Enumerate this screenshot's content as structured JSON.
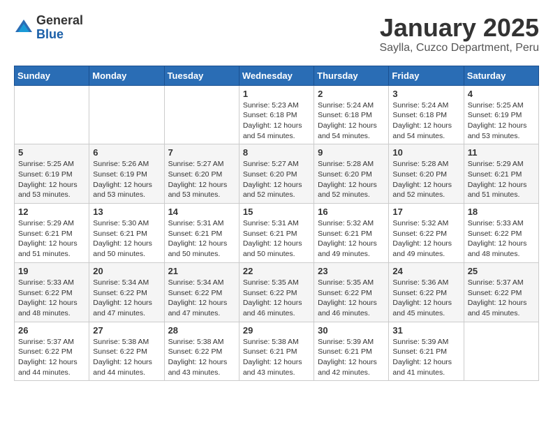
{
  "logo": {
    "general": "General",
    "blue": "Blue"
  },
  "title": "January 2025",
  "subtitle": "Saylla, Cuzco Department, Peru",
  "days_of_week": [
    "Sunday",
    "Monday",
    "Tuesday",
    "Wednesday",
    "Thursday",
    "Friday",
    "Saturday"
  ],
  "weeks": [
    [
      {
        "day": "",
        "info": ""
      },
      {
        "day": "",
        "info": ""
      },
      {
        "day": "",
        "info": ""
      },
      {
        "day": "1",
        "info": "Sunrise: 5:23 AM\nSunset: 6:18 PM\nDaylight: 12 hours\nand 54 minutes."
      },
      {
        "day": "2",
        "info": "Sunrise: 5:24 AM\nSunset: 6:18 PM\nDaylight: 12 hours\nand 54 minutes."
      },
      {
        "day": "3",
        "info": "Sunrise: 5:24 AM\nSunset: 6:18 PM\nDaylight: 12 hours\nand 54 minutes."
      },
      {
        "day": "4",
        "info": "Sunrise: 5:25 AM\nSunset: 6:19 PM\nDaylight: 12 hours\nand 53 minutes."
      }
    ],
    [
      {
        "day": "5",
        "info": "Sunrise: 5:25 AM\nSunset: 6:19 PM\nDaylight: 12 hours\nand 53 minutes."
      },
      {
        "day": "6",
        "info": "Sunrise: 5:26 AM\nSunset: 6:19 PM\nDaylight: 12 hours\nand 53 minutes."
      },
      {
        "day": "7",
        "info": "Sunrise: 5:27 AM\nSunset: 6:20 PM\nDaylight: 12 hours\nand 53 minutes."
      },
      {
        "day": "8",
        "info": "Sunrise: 5:27 AM\nSunset: 6:20 PM\nDaylight: 12 hours\nand 52 minutes."
      },
      {
        "day": "9",
        "info": "Sunrise: 5:28 AM\nSunset: 6:20 PM\nDaylight: 12 hours\nand 52 minutes."
      },
      {
        "day": "10",
        "info": "Sunrise: 5:28 AM\nSunset: 6:20 PM\nDaylight: 12 hours\nand 52 minutes."
      },
      {
        "day": "11",
        "info": "Sunrise: 5:29 AM\nSunset: 6:21 PM\nDaylight: 12 hours\nand 51 minutes."
      }
    ],
    [
      {
        "day": "12",
        "info": "Sunrise: 5:29 AM\nSunset: 6:21 PM\nDaylight: 12 hours\nand 51 minutes."
      },
      {
        "day": "13",
        "info": "Sunrise: 5:30 AM\nSunset: 6:21 PM\nDaylight: 12 hours\nand 50 minutes."
      },
      {
        "day": "14",
        "info": "Sunrise: 5:31 AM\nSunset: 6:21 PM\nDaylight: 12 hours\nand 50 minutes."
      },
      {
        "day": "15",
        "info": "Sunrise: 5:31 AM\nSunset: 6:21 PM\nDaylight: 12 hours\nand 50 minutes."
      },
      {
        "day": "16",
        "info": "Sunrise: 5:32 AM\nSunset: 6:21 PM\nDaylight: 12 hours\nand 49 minutes."
      },
      {
        "day": "17",
        "info": "Sunrise: 5:32 AM\nSunset: 6:22 PM\nDaylight: 12 hours\nand 49 minutes."
      },
      {
        "day": "18",
        "info": "Sunrise: 5:33 AM\nSunset: 6:22 PM\nDaylight: 12 hours\nand 48 minutes."
      }
    ],
    [
      {
        "day": "19",
        "info": "Sunrise: 5:33 AM\nSunset: 6:22 PM\nDaylight: 12 hours\nand 48 minutes."
      },
      {
        "day": "20",
        "info": "Sunrise: 5:34 AM\nSunset: 6:22 PM\nDaylight: 12 hours\nand 47 minutes."
      },
      {
        "day": "21",
        "info": "Sunrise: 5:34 AM\nSunset: 6:22 PM\nDaylight: 12 hours\nand 47 minutes."
      },
      {
        "day": "22",
        "info": "Sunrise: 5:35 AM\nSunset: 6:22 PM\nDaylight: 12 hours\nand 46 minutes."
      },
      {
        "day": "23",
        "info": "Sunrise: 5:35 AM\nSunset: 6:22 PM\nDaylight: 12 hours\nand 46 minutes."
      },
      {
        "day": "24",
        "info": "Sunrise: 5:36 AM\nSunset: 6:22 PM\nDaylight: 12 hours\nand 45 minutes."
      },
      {
        "day": "25",
        "info": "Sunrise: 5:37 AM\nSunset: 6:22 PM\nDaylight: 12 hours\nand 45 minutes."
      }
    ],
    [
      {
        "day": "26",
        "info": "Sunrise: 5:37 AM\nSunset: 6:22 PM\nDaylight: 12 hours\nand 44 minutes."
      },
      {
        "day": "27",
        "info": "Sunrise: 5:38 AM\nSunset: 6:22 PM\nDaylight: 12 hours\nand 44 minutes."
      },
      {
        "day": "28",
        "info": "Sunrise: 5:38 AM\nSunset: 6:22 PM\nDaylight: 12 hours\nand 43 minutes."
      },
      {
        "day": "29",
        "info": "Sunrise: 5:38 AM\nSunset: 6:21 PM\nDaylight: 12 hours\nand 43 minutes."
      },
      {
        "day": "30",
        "info": "Sunrise: 5:39 AM\nSunset: 6:21 PM\nDaylight: 12 hours\nand 42 minutes."
      },
      {
        "day": "31",
        "info": "Sunrise: 5:39 AM\nSunset: 6:21 PM\nDaylight: 12 hours\nand 41 minutes."
      },
      {
        "day": "",
        "info": ""
      }
    ]
  ]
}
